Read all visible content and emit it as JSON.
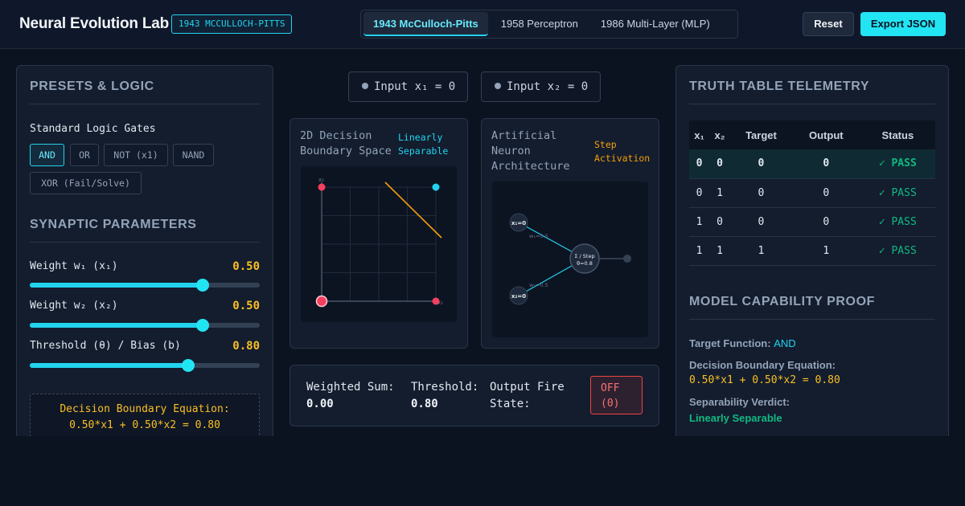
{
  "header": {
    "title": "Neural Evolution Lab",
    "era_badge": "1943 MCCULLOCH-PITTS",
    "tabs": [
      {
        "label": "1943 McCulloch-Pitts",
        "active": true
      },
      {
        "label": "1958 Perceptron",
        "active": false
      },
      {
        "label": "1986 Multi-Layer (MLP)",
        "active": false
      }
    ],
    "reset_label": "Reset",
    "export_label": "Export JSON"
  },
  "presets": {
    "title": "PRESETS & LOGIC",
    "gates_label": "Standard Logic Gates",
    "gates": [
      {
        "label": "AND",
        "active": true
      },
      {
        "label": "OR",
        "active": false
      },
      {
        "label": "NOT (x1)",
        "active": false
      },
      {
        "label": "NAND",
        "active": false
      },
      {
        "label": "XOR (Fail/Solve)",
        "active": false
      }
    ]
  },
  "synaptic": {
    "title": "SYNAPTIC PARAMETERS",
    "params": [
      {
        "label": "Weight w₁ (x₁)",
        "value": "0.50",
        "fraction": 0.75
      },
      {
        "label": "Weight w₂ (x₂)",
        "value": "0.50",
        "fraction": 0.75
      },
      {
        "label": "Threshold (θ) / Bias (b)",
        "value": "0.80",
        "fraction": 0.69
      }
    ],
    "equation": "Decision Boundary Equation: 0.50*x1 + 0.50*x2 = 0.80"
  },
  "inputs": {
    "x1": "Input x₁ = 0",
    "x2": "Input x₂ = 0"
  },
  "boundary_card": {
    "title_line1": "2D Decision",
    "title_line2": "Boundary Space",
    "tag_line1": "Linearly",
    "tag_line2": "Separable",
    "axis_x": "x₁",
    "axis_y": "x₂"
  },
  "neuron_card": {
    "title_line1": "Artificial",
    "title_line2": "Neuron",
    "title_line3": "Architecture",
    "tag_line1": "Step",
    "tag_line2": "Activation",
    "node_x1": "x₁=0",
    "node_x2": "x₂=0",
    "w1": "w₁=0.5",
    "w2": "w₂=0.5",
    "sum_line1": "Σ / Step",
    "sum_line2": "θ=0.8"
  },
  "status": {
    "sum_label": "Weighted Sum:",
    "sum_value": "0.00",
    "threshold_label": "Threshold:",
    "threshold_value": "0.80",
    "fire_label_line1": "Output Fire",
    "fire_label_line2": "State:",
    "fire_line1": "OFF",
    "fire_line2": "(0)"
  },
  "truth_table": {
    "title": "TRUTH TABLE TELEMETRY",
    "headers": [
      "x₁",
      "x₂",
      "Target",
      "Output",
      "Status"
    ],
    "rows": [
      [
        "0",
        "0",
        "0",
        "0",
        "✓ PASS"
      ],
      [
        "0",
        "1",
        "0",
        "0",
        "✓ PASS"
      ],
      [
        "1",
        "0",
        "0",
        "0",
        "✓ PASS"
      ],
      [
        "1",
        "1",
        "1",
        "1",
        "✓ PASS"
      ]
    ]
  },
  "proof": {
    "title": "MODEL CAPABILITY PROOF",
    "target_label": "Target Function:",
    "target_value": "AND",
    "eq_label": "Decision Boundary Equation:",
    "eq_value": "0.50*x1 + 0.50*x2 = 0.80",
    "verdict_label": "Separability Verdict:",
    "verdict_value": "Linearly Separable"
  },
  "colors": {
    "accent": "#22d3ee",
    "warning": "#fbbf24",
    "pass": "#10b981",
    "off": "#ef4444",
    "point_negative": "#f43f5e",
    "point_positive": "#22d3ee"
  }
}
